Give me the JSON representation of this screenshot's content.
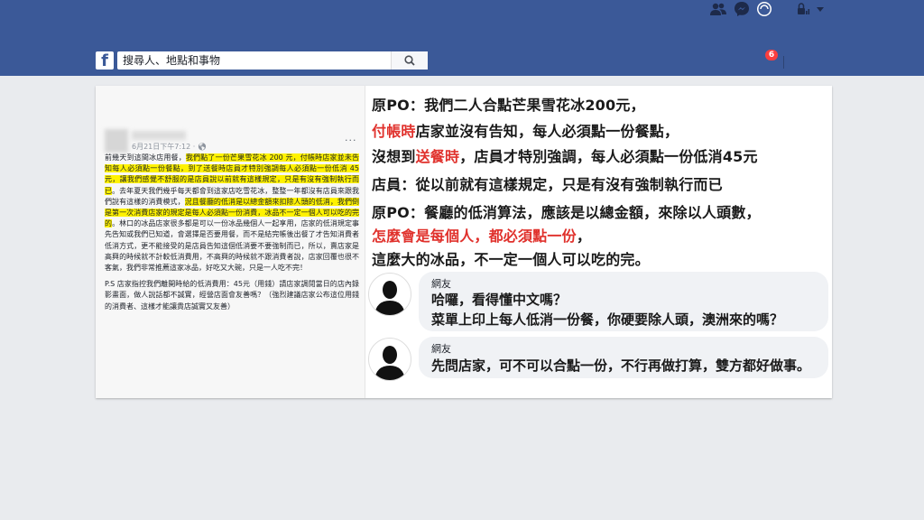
{
  "topbar": {
    "logo": "f",
    "search_placeholder": "搜尋人、地點和事物",
    "notification_count": "6",
    "icons": [
      "friend-requests-icon",
      "messenger-icon",
      "notifications-icon",
      "lock-icon",
      "caret-down-icon"
    ]
  },
  "post": {
    "timestamp": "6月21日下午7:12 ·",
    "more": "···",
    "paragraph1": {
      "lead": "前幾天到這間冰店用餐，",
      "highlight1": "我們點了一份芒果雪花冰 200 元，付帳時店家並未告知每人必須點一份餐點，到了送餐時店員才特別強調每人必須點一份低消 45 元，讓我們感覺不舒服的是店員說以前就有這樣規定，只是有沒有強制執行而已",
      "mid": "。去年夏天我們幾乎每天都會到這家店吃雪花冰，整整一年都沒有店員來跟我們說有這樣的消費模式，",
      "highlight2": "況且餐廳的低消是以總金額來扣除人頭的低消，我們倒是第一次消費店家的規定是每人必須點一份消費，冰品不一定一個人可以吃的完的",
      "tail": "。林口的冰品店家很多都是可以一份冰品幾個人一起享用，店家的低消規定事先告知或我們已知道，會選擇是否要用餐，而不是結完帳後出餐了才告知消費者低消方式，更不能接受的是店員告知這個低消要不要強制而已，所以，賣店家是高興的時候就不計較低消費用，不高興的時候就不跟消費者說，店家回覆也很不客氣，我們非常推薦這家冰品，好吃又大碗，只是一人吃不完！"
    },
    "paragraph2": "P.S 店家指控我們離開時給的低消費用：45元（用錢）請店家調閱當日的店內錄影畫面，做人說話都不誠實，經營店面會友善嗎？（強烈建議店家公布這位用錢的消費者、這樣才能讓貴店誠實又友善）"
  },
  "quote": {
    "line1": "原PO：我們二人合點芒果雪花冰200元，",
    "line2_red": "付帳時",
    "line2_rest": "店家並沒有告知，每人必須點一份餐點，",
    "line3_a": "沒想到",
    "line3_red": "送餐時",
    "line3_rest": "，店員才特別強調，每人必須點一份低消45元",
    "line4": "店員：從以前就有這樣規定，只是有沒有強制執行而已",
    "line5": "原PO：餐廳的低消算法，應該是以總金額，來除以人頭數，",
    "line6_red": "怎麼會是每個人，都必須點一份",
    "line6_rest": "，",
    "line7": "這麼大的冰品，不一定一個人可以吃的完。"
  },
  "comments": [
    {
      "name": "網友",
      "lines": [
        "哈囉，看得懂中文嗎？",
        "菜單上印上每人低消一份餐，你硬要除人頭，澳洲來的嗎？"
      ]
    },
    {
      "name": "網友",
      "lines": [
        "先問店家，可不可以合點一份，不行再做打算，雙方都好做事。"
      ]
    }
  ],
  "colors": {
    "facebook_blue": "#3b5998",
    "highlight": "#fff200",
    "emphasis_red": "#e0312c",
    "badge_red": "#fa3e3e"
  }
}
